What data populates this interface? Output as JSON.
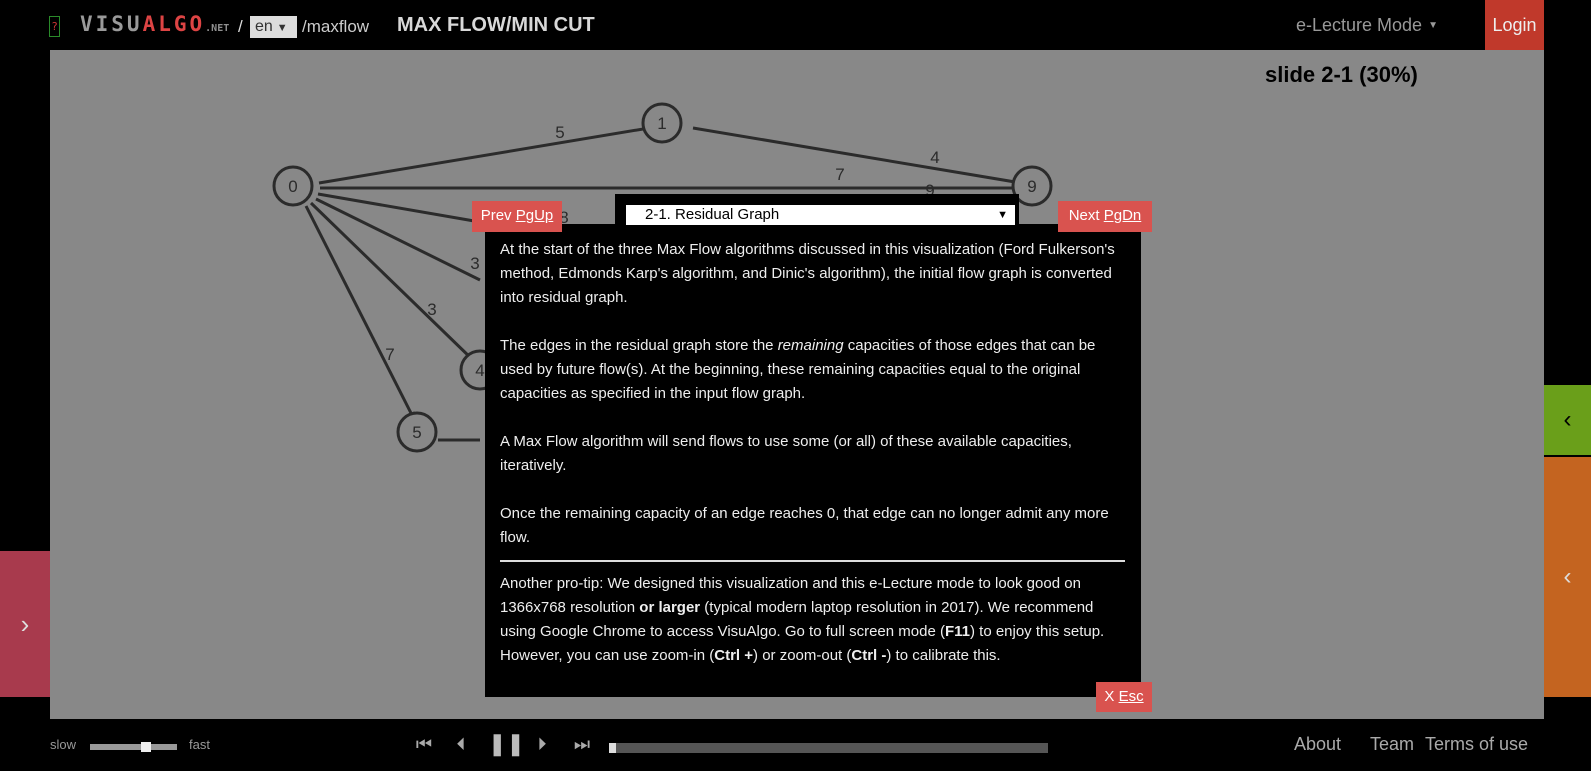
{
  "header": {
    "question_badge": "?",
    "logo": {
      "part1": "VISU",
      "part2": "ALGO",
      "net": ".NET"
    },
    "logo_slash": "/",
    "language": "en",
    "path": "/maxflow",
    "title": "MAX FLOW/MIN CUT",
    "mode": "e-Lecture Mode",
    "login": "Login"
  },
  "slide_indicator": "slide 2-1 (30%)",
  "graph": {
    "nodes": [
      {
        "id": "0",
        "label": "0"
      },
      {
        "id": "1",
        "label": "1"
      },
      {
        "id": "9",
        "label": "9"
      },
      {
        "id": "4",
        "label": "4"
      },
      {
        "id": "5",
        "label": "5"
      }
    ],
    "edge_labels": [
      "5",
      "4",
      "7",
      "9",
      "8",
      "3",
      "3",
      "7"
    ]
  },
  "electure": {
    "slide_select": "2-1. Residual Graph",
    "prev": {
      "label": "Prev",
      "key": "PgUp"
    },
    "next": {
      "label": "Next",
      "key": "PgDn"
    },
    "esc": {
      "label": "X",
      "key": "Esc"
    },
    "p1": "At the start of the three Max Flow algorithms discussed in this visualization (Ford Fulkerson's method, Edmonds Karp's algorithm, and Dinic's algorithm), the initial flow graph is converted into residual graph.",
    "p2_a": "The edges in the residual graph store the ",
    "p2_em": "remaining",
    "p2_b": " capacities of those edges that can be used by future flow(s). At the beginning, these remaining capacities equal to the original capacities as specified in the input flow graph.",
    "p3": "A Max Flow algorithm will send flows to use some (or all) of these available capacities, iteratively.",
    "p4": "Once the remaining capacity of an edge reaches 0, that edge can no longer admit any more flow.",
    "tip_a": "Another pro-tip: We designed this visualization and this e-Lecture mode to look good on 1366x768 resolution ",
    "tip_b1": "or larger",
    "tip_c": " (typical modern laptop resolution in 2017). We recommend using Google Chrome to access VisuAlgo. Go to full screen mode (",
    "tip_b2": "F11",
    "tip_d": ") to enjoy this setup. However, you can use zoom-in (",
    "tip_b3": "Ctrl +",
    "tip_e": ") or zoom-out (",
    "tip_b4": "Ctrl -",
    "tip_f": ") to calibrate this."
  },
  "side": {
    "left_arrow": "›",
    "right_green_arrow": "‹",
    "right_orange_arrow": "‹"
  },
  "bottom": {
    "slow": "slow",
    "fast": "fast",
    "speed_fraction": 0.66,
    "progress_fraction": 0.015,
    "media": {
      "first": "⏮",
      "back": "⏴",
      "pause": "❚❚",
      "fwd": "⏵",
      "last": "⏭"
    },
    "about": "About",
    "team": "Team",
    "terms": "Terms of use"
  },
  "colors": {
    "accent_red": "#d9534f",
    "login_red": "#c0392b",
    "green": "#6a9f1a",
    "orange": "#c46420",
    "pink": "#a83a4d",
    "viz_bg": "#888888"
  }
}
